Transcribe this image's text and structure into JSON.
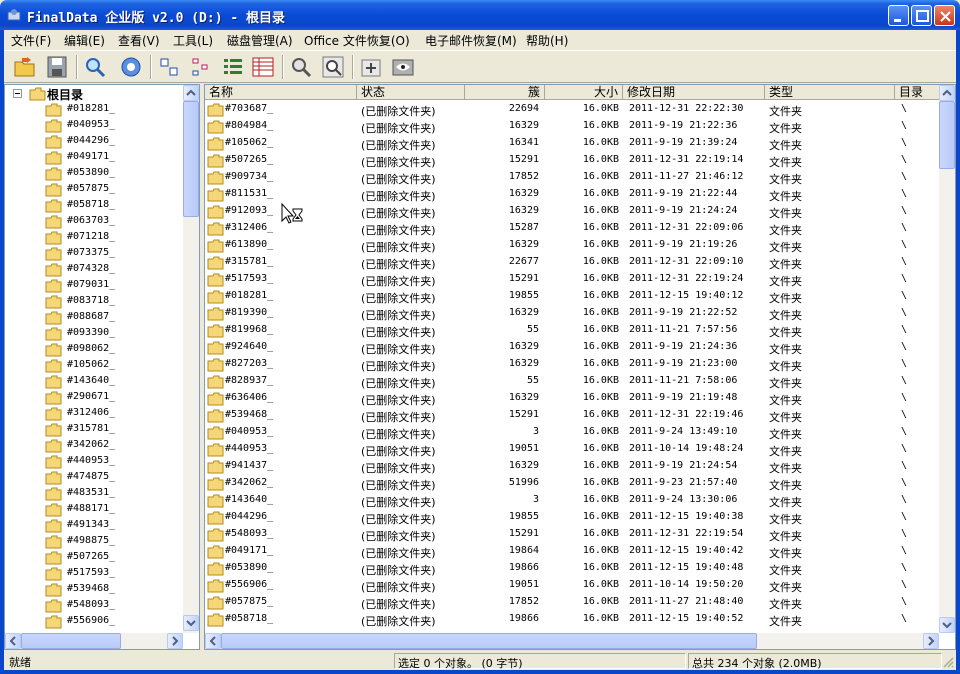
{
  "window": {
    "title": "FinalData 企业版 v2.0 (D:) - 根目录"
  },
  "menu": [
    "文件(F)",
    "编辑(E)",
    "查看(V)",
    "工具(L)",
    "磁盘管理(A)",
    "Office 文件恢复(O)",
    "电子邮件恢复(M)",
    "帮助(H)"
  ],
  "toolbar": {
    "icons": [
      "open-folder-icon",
      "save-icon",
      "search-icon",
      "settings-gear-icon",
      "large-icons-view-icon",
      "small-icons-view-icon",
      "list-view-icon",
      "details-view-icon",
      "find-icon",
      "find-all-icon",
      "add-icon",
      "preview-icon"
    ]
  },
  "tree": {
    "root_label": "根目录",
    "items": [
      "#018281_",
      "#040953_",
      "#044296_",
      "#049171_",
      "#053890_",
      "#057875_",
      "#058718_",
      "#063703_",
      "#071218_",
      "#073375_",
      "#074328_",
      "#079031_",
      "#083718_",
      "#088687_",
      "#093390_",
      "#098062_",
      "#105062_",
      "#143640_",
      "#290671_",
      "#312406_",
      "#315781_",
      "#342062_",
      "#440953_",
      "#474875_",
      "#483531_",
      "#488171_",
      "#491343_",
      "#498875_",
      "#507265_",
      "#517593_",
      "#539468_",
      "#548093_",
      "#556906_"
    ]
  },
  "columns": {
    "name": "名称",
    "status": "状态",
    "cluster": "簇",
    "size": "大小",
    "modified": "修改日期",
    "type": "类型",
    "dir": "目录"
  },
  "files": [
    {
      "name": "#703687_",
      "status": "(已删除文件夹)",
      "cluster": "22694",
      "size": "16.0KB",
      "modified": "2011-12-31 22:22:30",
      "type": "文件夹",
      "dir": "\\"
    },
    {
      "name": "#804984_",
      "status": "(已删除文件夹)",
      "cluster": "16329",
      "size": "16.0KB",
      "modified": "2011-9-19 21:22:36",
      "type": "文件夹",
      "dir": "\\"
    },
    {
      "name": "#105062_",
      "status": "(已删除文件夹)",
      "cluster": "16341",
      "size": "16.0KB",
      "modified": "2011-9-19 21:39:24",
      "type": "文件夹",
      "dir": "\\"
    },
    {
      "name": "#507265_",
      "status": "(已删除文件夹)",
      "cluster": "15291",
      "size": "16.0KB",
      "modified": "2011-12-31 22:19:14",
      "type": "文件夹",
      "dir": "\\"
    },
    {
      "name": "#909734_",
      "status": "(已删除文件夹)",
      "cluster": "17852",
      "size": "16.0KB",
      "modified": "2011-11-27 21:46:12",
      "type": "文件夹",
      "dir": "\\"
    },
    {
      "name": "#811531_",
      "status": "(已删除文件夹)",
      "cluster": "16329",
      "size": "16.0KB",
      "modified": "2011-9-19 21:22:44",
      "type": "文件夹",
      "dir": "\\"
    },
    {
      "name": "#912093_",
      "status": "(已删除文件夹)",
      "cluster": "16329",
      "size": "16.0KB",
      "modified": "2011-9-19 21:24:24",
      "type": "文件夹",
      "dir": "\\"
    },
    {
      "name": "#312406_",
      "status": "(已删除文件夹)",
      "cluster": "15287",
      "size": "16.0KB",
      "modified": "2011-12-31 22:09:06",
      "type": "文件夹",
      "dir": "\\"
    },
    {
      "name": "#613890_",
      "status": "(已删除文件夹)",
      "cluster": "16329",
      "size": "16.0KB",
      "modified": "2011-9-19 21:19:26",
      "type": "文件夹",
      "dir": "\\"
    },
    {
      "name": "#315781_",
      "status": "(已删除文件夹)",
      "cluster": "22677",
      "size": "16.0KB",
      "modified": "2011-12-31 22:09:10",
      "type": "文件夹",
      "dir": "\\"
    },
    {
      "name": "#517593_",
      "status": "(已删除文件夹)",
      "cluster": "15291",
      "size": "16.0KB",
      "modified": "2011-12-31 22:19:24",
      "type": "文件夹",
      "dir": "\\"
    },
    {
      "name": "#018281_",
      "status": "(已删除文件夹)",
      "cluster": "19855",
      "size": "16.0KB",
      "modified": "2011-12-15 19:40:12",
      "type": "文件夹",
      "dir": "\\"
    },
    {
      "name": "#819390_",
      "status": "(已删除文件夹)",
      "cluster": "16329",
      "size": "16.0KB",
      "modified": "2011-9-19 21:22:52",
      "type": "文件夹",
      "dir": "\\"
    },
    {
      "name": "#819968_",
      "status": "(已删除文件夹)",
      "cluster": "55",
      "size": "16.0KB",
      "modified": "2011-11-21 7:57:56",
      "type": "文件夹",
      "dir": "\\"
    },
    {
      "name": "#924640_",
      "status": "(已删除文件夹)",
      "cluster": "16329",
      "size": "16.0KB",
      "modified": "2011-9-19 21:24:36",
      "type": "文件夹",
      "dir": "\\"
    },
    {
      "name": "#827203_",
      "status": "(已删除文件夹)",
      "cluster": "16329",
      "size": "16.0KB",
      "modified": "2011-9-19 21:23:00",
      "type": "文件夹",
      "dir": "\\"
    },
    {
      "name": "#828937_",
      "status": "(已删除文件夹)",
      "cluster": "55",
      "size": "16.0KB",
      "modified": "2011-11-21 7:58:06",
      "type": "文件夹",
      "dir": "\\"
    },
    {
      "name": "#636406_",
      "status": "(已删除文件夹)",
      "cluster": "16329",
      "size": "16.0KB",
      "modified": "2011-9-19 21:19:48",
      "type": "文件夹",
      "dir": "\\"
    },
    {
      "name": "#539468_",
      "status": "(已删除文件夹)",
      "cluster": "15291",
      "size": "16.0KB",
      "modified": "2011-12-31 22:19:46",
      "type": "文件夹",
      "dir": "\\"
    },
    {
      "name": "#040953_",
      "status": "(已删除文件夹)",
      "cluster": "3",
      "size": "16.0KB",
      "modified": "2011-9-24 13:49:10",
      "type": "文件夹",
      "dir": "\\"
    },
    {
      "name": "#440953_",
      "status": "(已删除文件夹)",
      "cluster": "19051",
      "size": "16.0KB",
      "modified": "2011-10-14 19:48:24",
      "type": "文件夹",
      "dir": "\\"
    },
    {
      "name": "#941437_",
      "status": "(已删除文件夹)",
      "cluster": "16329",
      "size": "16.0KB",
      "modified": "2011-9-19 21:24:54",
      "type": "文件夹",
      "dir": "\\"
    },
    {
      "name": "#342062_",
      "status": "(已删除文件夹)",
      "cluster": "51996",
      "size": "16.0KB",
      "modified": "2011-9-23 21:57:40",
      "type": "文件夹",
      "dir": "\\"
    },
    {
      "name": "#143640_",
      "status": "(已删除文件夹)",
      "cluster": "3",
      "size": "16.0KB",
      "modified": "2011-9-24 13:30:06",
      "type": "文件夹",
      "dir": "\\"
    },
    {
      "name": "#044296_",
      "status": "(已删除文件夹)",
      "cluster": "19855",
      "size": "16.0KB",
      "modified": "2011-12-15 19:40:38",
      "type": "文件夹",
      "dir": "\\"
    },
    {
      "name": "#548093_",
      "status": "(已删除文件夹)",
      "cluster": "15291",
      "size": "16.0KB",
      "modified": "2011-12-31 22:19:54",
      "type": "文件夹",
      "dir": "\\"
    },
    {
      "name": "#049171_",
      "status": "(已删除文件夹)",
      "cluster": "19864",
      "size": "16.0KB",
      "modified": "2011-12-15 19:40:42",
      "type": "文件夹",
      "dir": "\\"
    },
    {
      "name": "#053890_",
      "status": "(已删除文件夹)",
      "cluster": "19866",
      "size": "16.0KB",
      "modified": "2011-12-15 19:40:48",
      "type": "文件夹",
      "dir": "\\"
    },
    {
      "name": "#556906_",
      "status": "(已删除文件夹)",
      "cluster": "19051",
      "size": "16.0KB",
      "modified": "2011-10-14 19:50:20",
      "type": "文件夹",
      "dir": "\\"
    },
    {
      "name": "#057875_",
      "status": "(已删除文件夹)",
      "cluster": "17852",
      "size": "16.0KB",
      "modified": "2011-11-27 21:48:40",
      "type": "文件夹",
      "dir": "\\"
    },
    {
      "name": "#058718_",
      "status": "(已删除文件夹)",
      "cluster": "19866",
      "size": "16.0KB",
      "modified": "2011-12-15 19:40:52",
      "type": "文件夹",
      "dir": "\\"
    }
  ],
  "status": {
    "ready": "就绪",
    "selection": "选定 0 个对象。 (0 字节)",
    "total": "总共 234 个对象 (2.0MB)"
  },
  "colors": {
    "titlebar": "#0A46C9",
    "folder": "#F5D77A"
  }
}
